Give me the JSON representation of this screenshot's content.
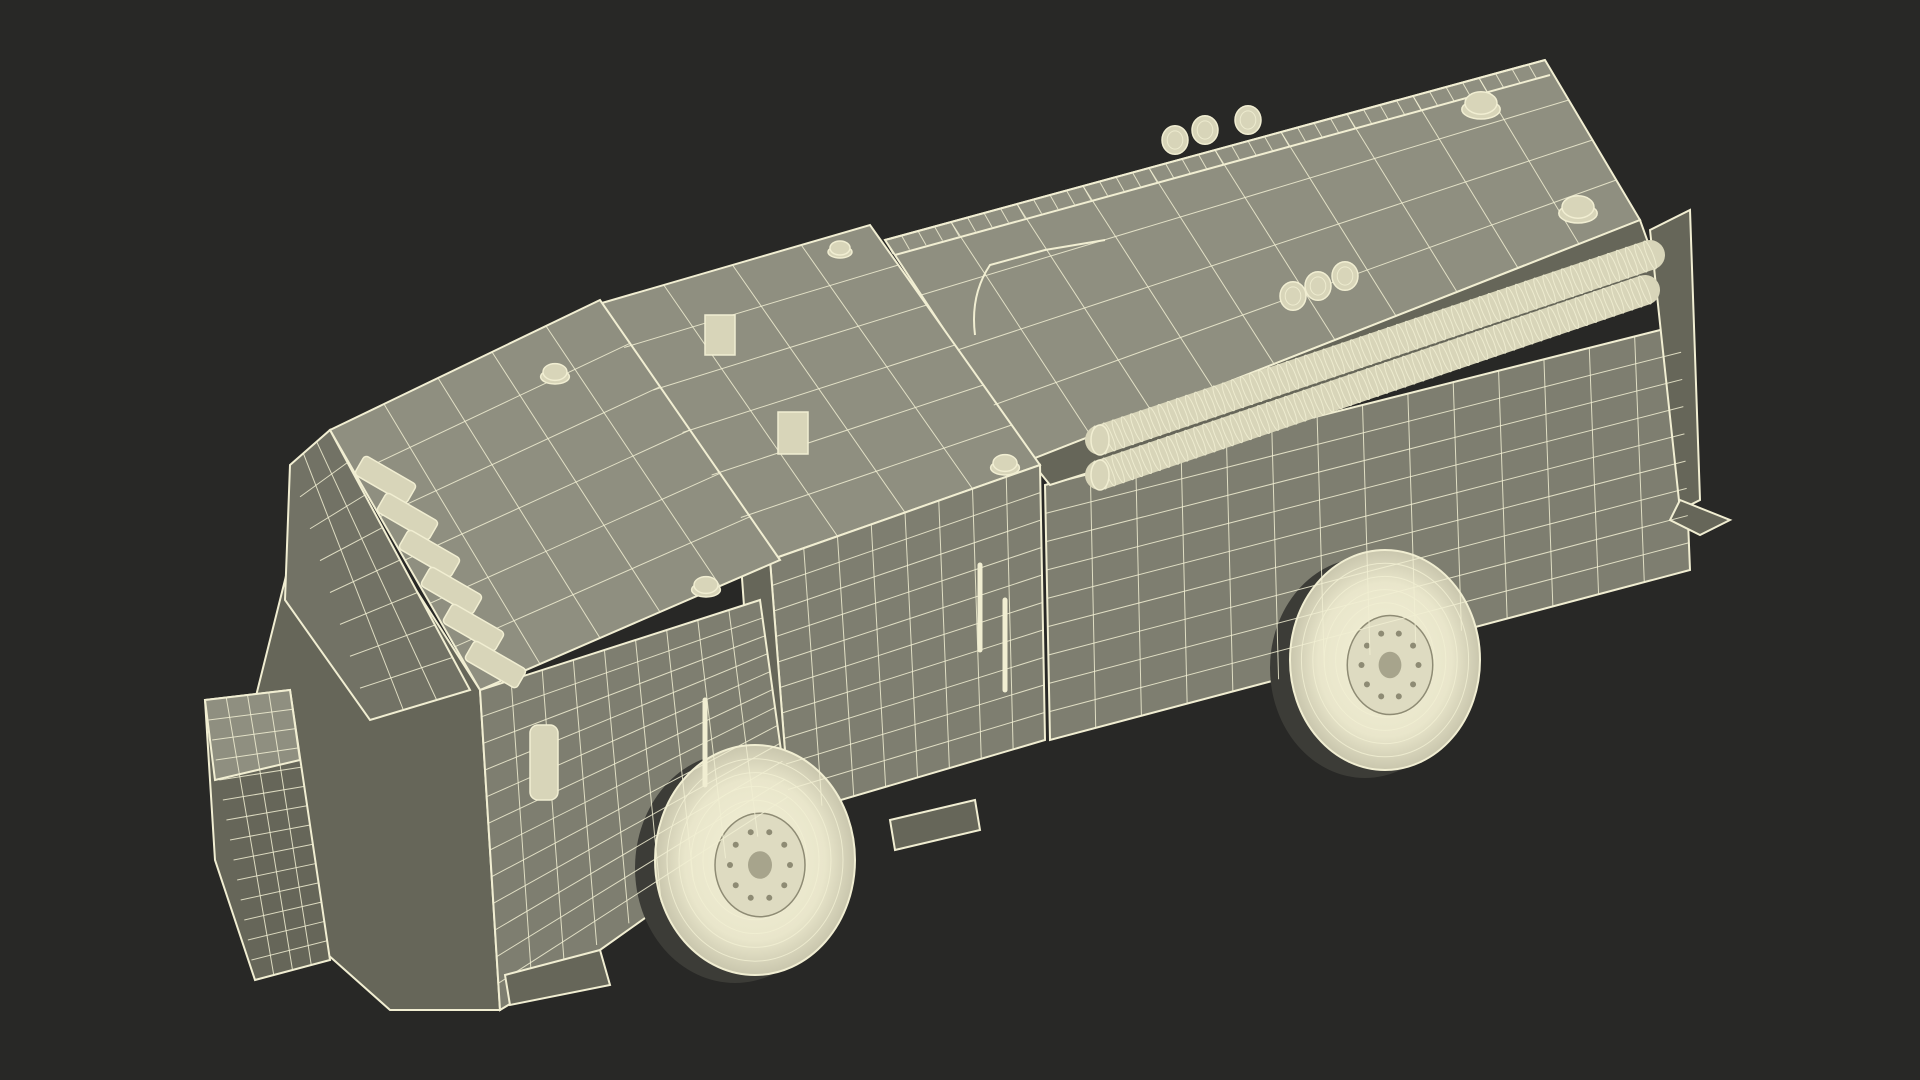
{
  "scene": {
    "subject": "fire-truck-wireframe",
    "background_color": "#282826",
    "surface_color": "#7e7e70",
    "surface_dark": "#666659",
    "surface_light": "#8f8f80",
    "wire_color": "#f1eed2",
    "wire_dim": "#d8d5b9"
  }
}
